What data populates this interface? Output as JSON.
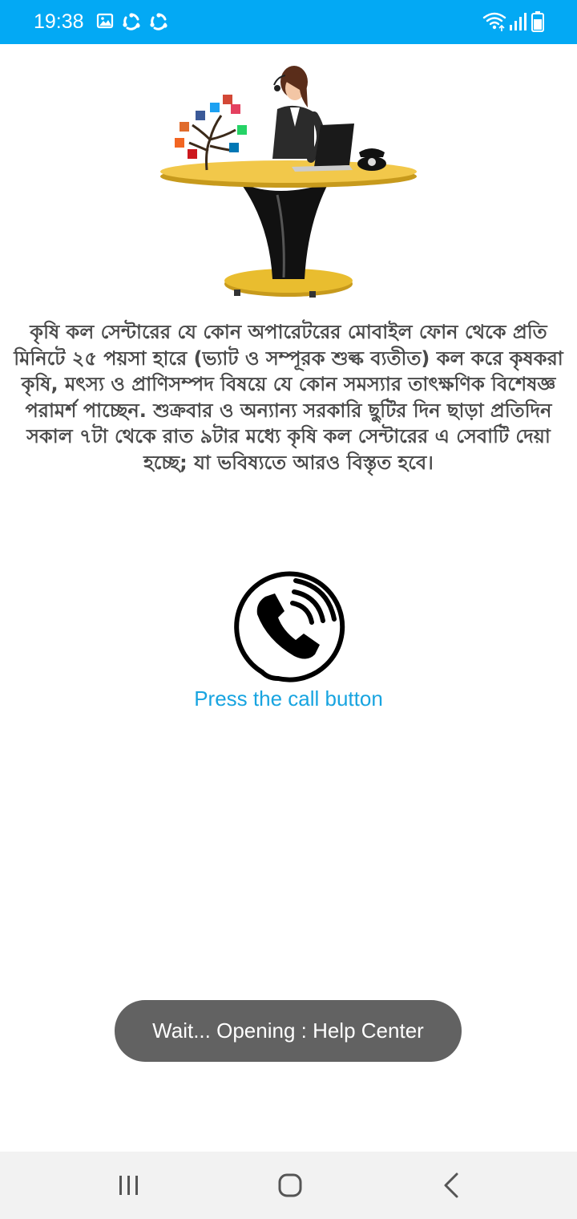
{
  "status_bar": {
    "time": "19:38",
    "left_icons": [
      "gallery-icon",
      "sync-icon",
      "sync-icon"
    ],
    "right_icons": [
      "wifi-icon",
      "signal-icon",
      "battery-icon"
    ],
    "background": "#03a9f4"
  },
  "hero": {
    "illustration": "call-center-agent-illustration"
  },
  "description": {
    "text": "কৃষি কল সেন্টারের যে কোন অপারেটরের মোবাইল ফোন থেকে প্রতি মিনিটে ২৫ পয়সা হারে (ভ্যাট ও সম্পূরক শুল্ক ব্যতীত) কল করে কৃষকরা কৃষি, মৎস্য ও প্রাণিসম্পদ বিষয়ে যে কোন সমস্যার তাৎক্ষণিক বিশেষজ্ঞ পরামর্শ পাচ্ছেন. শুক্রবার ও অন্যান্য সরকারি ছুটির দিন ছাড়া প্রতিদিন সকাল ৭টা থেকে রাত ৯টার মধ্যে কৃষি কল সেন্টারের এ সেবাটি দেয়া হচ্ছে; যা ভবিষ্যতে আরও বিস্তৃত হবে।"
  },
  "call": {
    "icon": "phone-call-icon",
    "caption": "Press the call button",
    "caption_color": "#18a4e0"
  },
  "toast": {
    "message": "Wait... Opening : Help Center"
  },
  "nav_bar": {
    "buttons": [
      "recent-apps-icon",
      "home-icon",
      "back-icon"
    ]
  }
}
